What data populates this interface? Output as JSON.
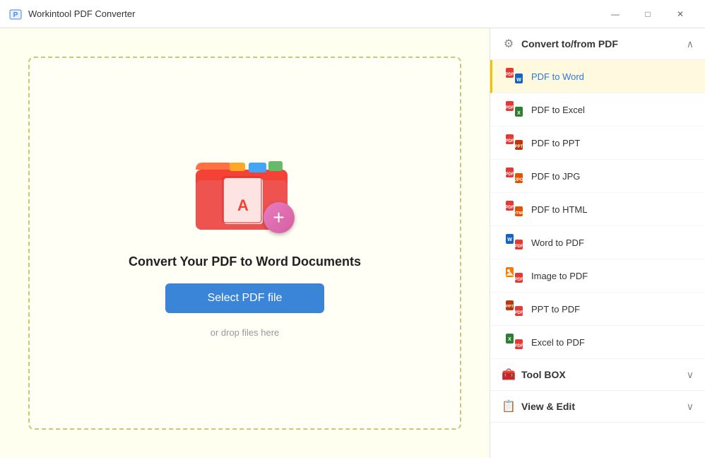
{
  "titleBar": {
    "appName": "Workintool PDF Converter",
    "controls": {
      "minimize": "—",
      "maximize": "□",
      "close": "✕"
    }
  },
  "leftPanel": {
    "title": "Convert Your PDF to Word Documents",
    "selectButton": "Select PDF file",
    "dropHint": "or drop files here"
  },
  "sidebar": {
    "sections": [
      {
        "id": "convert",
        "title": "Convert to/from PDF",
        "collapsed": false,
        "chevron": "∧",
        "items": [
          {
            "id": "pdf-to-word",
            "label": "PDF to Word",
            "active": true
          },
          {
            "id": "pdf-to-excel",
            "label": "PDF to Excel",
            "active": false
          },
          {
            "id": "pdf-to-ppt",
            "label": "PDF to PPT",
            "active": false
          },
          {
            "id": "pdf-to-jpg",
            "label": "PDF to JPG",
            "active": false
          },
          {
            "id": "pdf-to-html",
            "label": "PDF to HTML",
            "active": false
          },
          {
            "id": "word-to-pdf",
            "label": "Word to PDF",
            "active": false
          },
          {
            "id": "image-to-pdf",
            "label": "Image to PDF",
            "active": false
          },
          {
            "id": "ppt-to-pdf",
            "label": "PPT to PDF",
            "active": false
          },
          {
            "id": "excel-to-pdf",
            "label": "Excel to PDF",
            "active": false
          }
        ]
      },
      {
        "id": "toolbox",
        "title": "Tool BOX",
        "collapsed": true,
        "chevron": "∨"
      },
      {
        "id": "view-edit",
        "title": "View & Edit",
        "collapsed": true,
        "chevron": "∨"
      }
    ]
  }
}
